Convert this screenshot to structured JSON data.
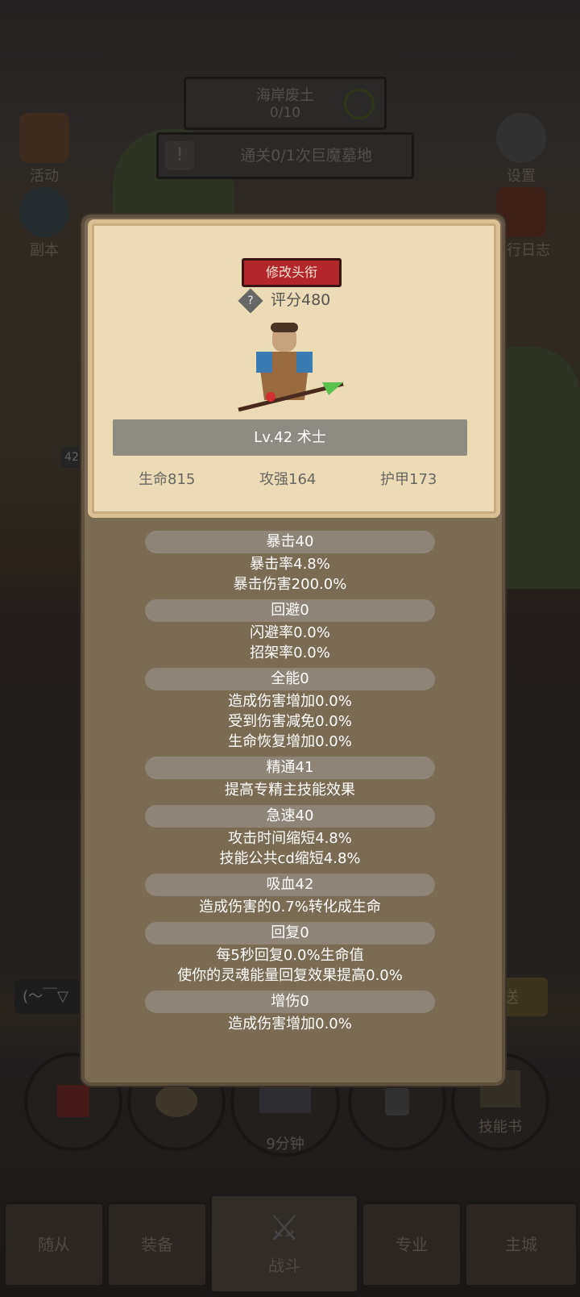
{
  "top": {
    "location": "海岸废土",
    "progress": "0/10",
    "quest": "通关0/1次巨魔墓地"
  },
  "side": {
    "activity": "活动",
    "dungeon": "副本",
    "settings": "设置",
    "journal": "旅行日志"
  },
  "level_badge": "42",
  "card": {
    "modify_title_button": "修改头衔",
    "score": "评分480",
    "level_class": "Lv.42 术士",
    "hp": "生命815",
    "attack": "攻强164",
    "armor": "护甲173"
  },
  "stats": [
    {
      "header": "暴击40",
      "lines": [
        "暴击率4.8%",
        "暴击伤害200.0%"
      ]
    },
    {
      "header": "回避0",
      "lines": [
        "闪避率0.0%",
        "招架率0.0%"
      ]
    },
    {
      "header": "全能0",
      "lines": [
        "造成伤害增加0.0%",
        "受到伤害减免0.0%",
        "生命恢复增加0.0%"
      ]
    },
    {
      "header": "精通41",
      "lines": [
        "提高专精主技能效果"
      ]
    },
    {
      "header": "急速40",
      "lines": [
        "攻击时间缩短4.8%",
        "技能公共cd缩短4.8%"
      ]
    },
    {
      "header": "吸血42",
      "lines": [
        "造成伤害的0.7%转化成生命"
      ]
    },
    {
      "header": "回复0",
      "lines": [
        "每5秒回复0.0%生命值",
        "使你的灵魂能量回复效果提高0.0%"
      ]
    },
    {
      "header": "增伤0",
      "lines": [
        "造成伤害增加0.0%"
      ]
    }
  ],
  "chat": {
    "emote": "(～￣▽",
    "send": "发送"
  },
  "bottom_actions": {
    "timer": "9分钟",
    "skill_book": "技能书"
  },
  "nav": {
    "followers": "随从",
    "equipment": "装备",
    "battle": "战斗",
    "profession": "专业",
    "guild": "主城"
  }
}
